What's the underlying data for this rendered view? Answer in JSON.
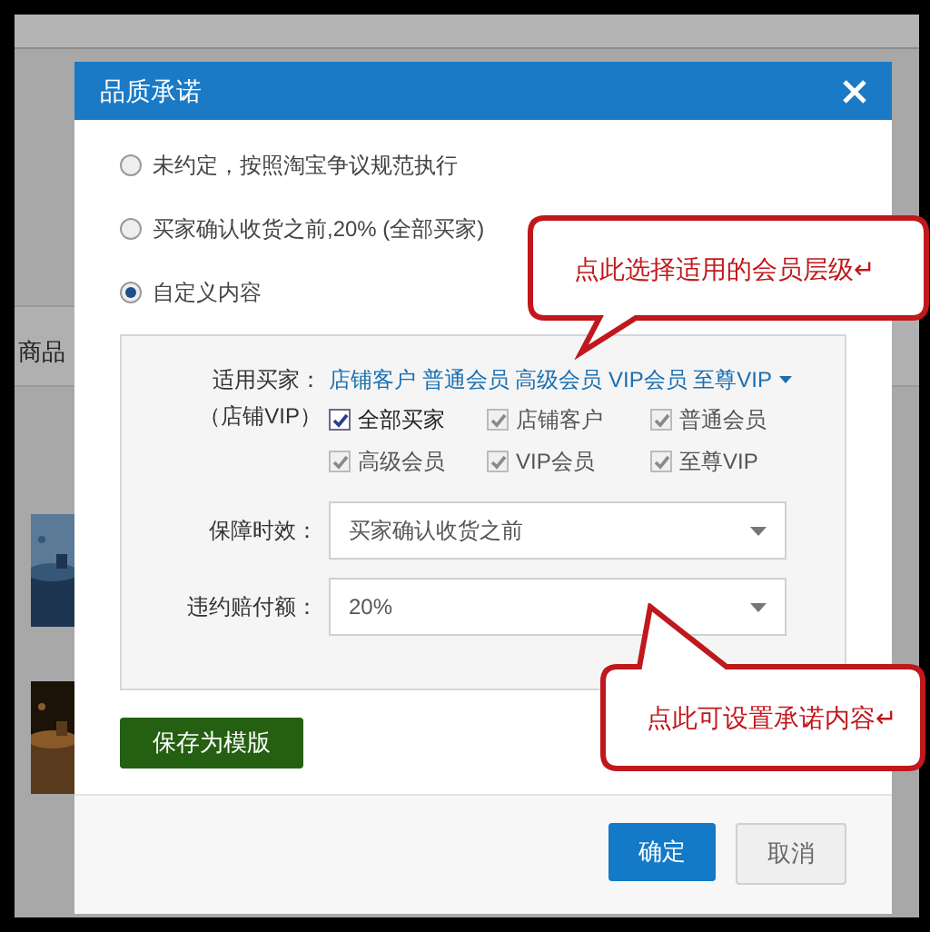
{
  "background": {
    "side_text": "商品"
  },
  "dialog": {
    "title": "品质承诺",
    "options": [
      {
        "label": "未约定，按照淘宝争议规范执行",
        "selected": false
      },
      {
        "label": "买家确认收货之前,20% (全部买家)",
        "selected": false
      },
      {
        "label": "自定义内容",
        "selected": true
      }
    ],
    "buyers": {
      "label": "适用买家：",
      "sublabel": "（店铺VIP）",
      "summary": "店铺客户 普通会员 高级会员 VIP会员 至尊VIP",
      "checkboxes": [
        {
          "label": "全部买家",
          "checked": true,
          "disabled": false
        },
        {
          "label": "店铺客户",
          "checked": true,
          "disabled": true
        },
        {
          "label": "普通会员",
          "checked": true,
          "disabled": true
        },
        {
          "label": "高级会员",
          "checked": true,
          "disabled": true
        },
        {
          "label": "VIP会员",
          "checked": true,
          "disabled": true
        },
        {
          "label": "至尊VIP",
          "checked": true,
          "disabled": true
        }
      ]
    },
    "fields": [
      {
        "label": "保障时效：",
        "value": "买家确认收货之前"
      },
      {
        "label": "违约赔付额：",
        "value": "20%"
      }
    ],
    "save_button": "保存为模版",
    "buttons": [
      {
        "label": "确定",
        "kind": "primary"
      },
      {
        "label": "取消",
        "kind": "secondary"
      }
    ]
  },
  "callouts": [
    {
      "text": "点此选择适用的会员层级↵",
      "kind": "downward"
    },
    {
      "text": "点此可设置承诺内容↵",
      "kind": "upward"
    }
  ]
}
